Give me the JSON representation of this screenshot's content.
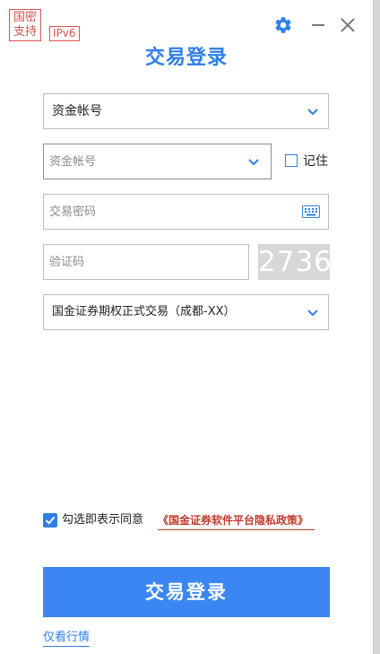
{
  "header": {
    "cert_badge": "国密\n支持",
    "ipv6_badge": "IPv6",
    "title": "交易登录",
    "icons": [
      "gear-icon",
      "minimize-icon",
      "close-icon"
    ]
  },
  "form": {
    "account_type": {
      "value": "资金帐号"
    },
    "account_input": {
      "placeholder": "资金帐号",
      "value": ""
    },
    "remember": {
      "label": "记住",
      "checked": false
    },
    "password_input": {
      "placeholder": "交易密码",
      "value": ""
    },
    "captcha_input": {
      "placeholder": "验证码",
      "value": ""
    },
    "captcha_code": "2736",
    "server": {
      "value": "国金证券期权正式交易（成都-XX）"
    }
  },
  "agreement": {
    "checked": true,
    "text": "勾选即表示同意",
    "policy_link": "《国金证券软件平台隐私政策》"
  },
  "actions": {
    "login_button": "交易登录",
    "quote_link": "仅看行情"
  },
  "colors": {
    "accent": "#2f7fe8",
    "button": "#3b86f2",
    "badge_red": "#d9534f",
    "policy_red": "#c0392b",
    "captcha_bg": "#d7d7d7"
  }
}
